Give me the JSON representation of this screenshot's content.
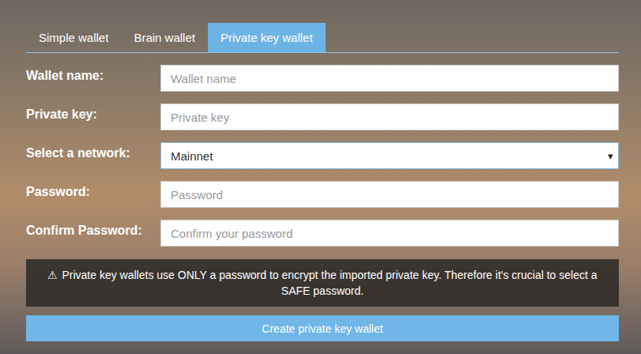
{
  "tabs": [
    {
      "label": "Simple wallet",
      "selected": false
    },
    {
      "label": "Brain wallet",
      "selected": false
    },
    {
      "label": "Private key wallet",
      "selected": true
    }
  ],
  "form": {
    "fields": [
      {
        "label": "Wallet name:",
        "kind": "input",
        "placeholder": "Wallet name"
      },
      {
        "label": "Private key:",
        "kind": "input",
        "placeholder": "Private key"
      },
      {
        "label": "Select a network:",
        "kind": "select",
        "value": "Mainnet",
        "icon": "▾"
      },
      {
        "label": "Password:",
        "kind": "input",
        "placeholder": "Password"
      },
      {
        "label": "Confirm Password:",
        "kind": "input",
        "placeholder": "Confirm your password"
      }
    ]
  },
  "warning": {
    "icon": "⚠",
    "text": "Private key wallets use ONLY a password to encrypt the imported private key. Therefore it's crucial to select a SAFE password."
  },
  "submit": {
    "label": "Create private key wallet"
  }
}
